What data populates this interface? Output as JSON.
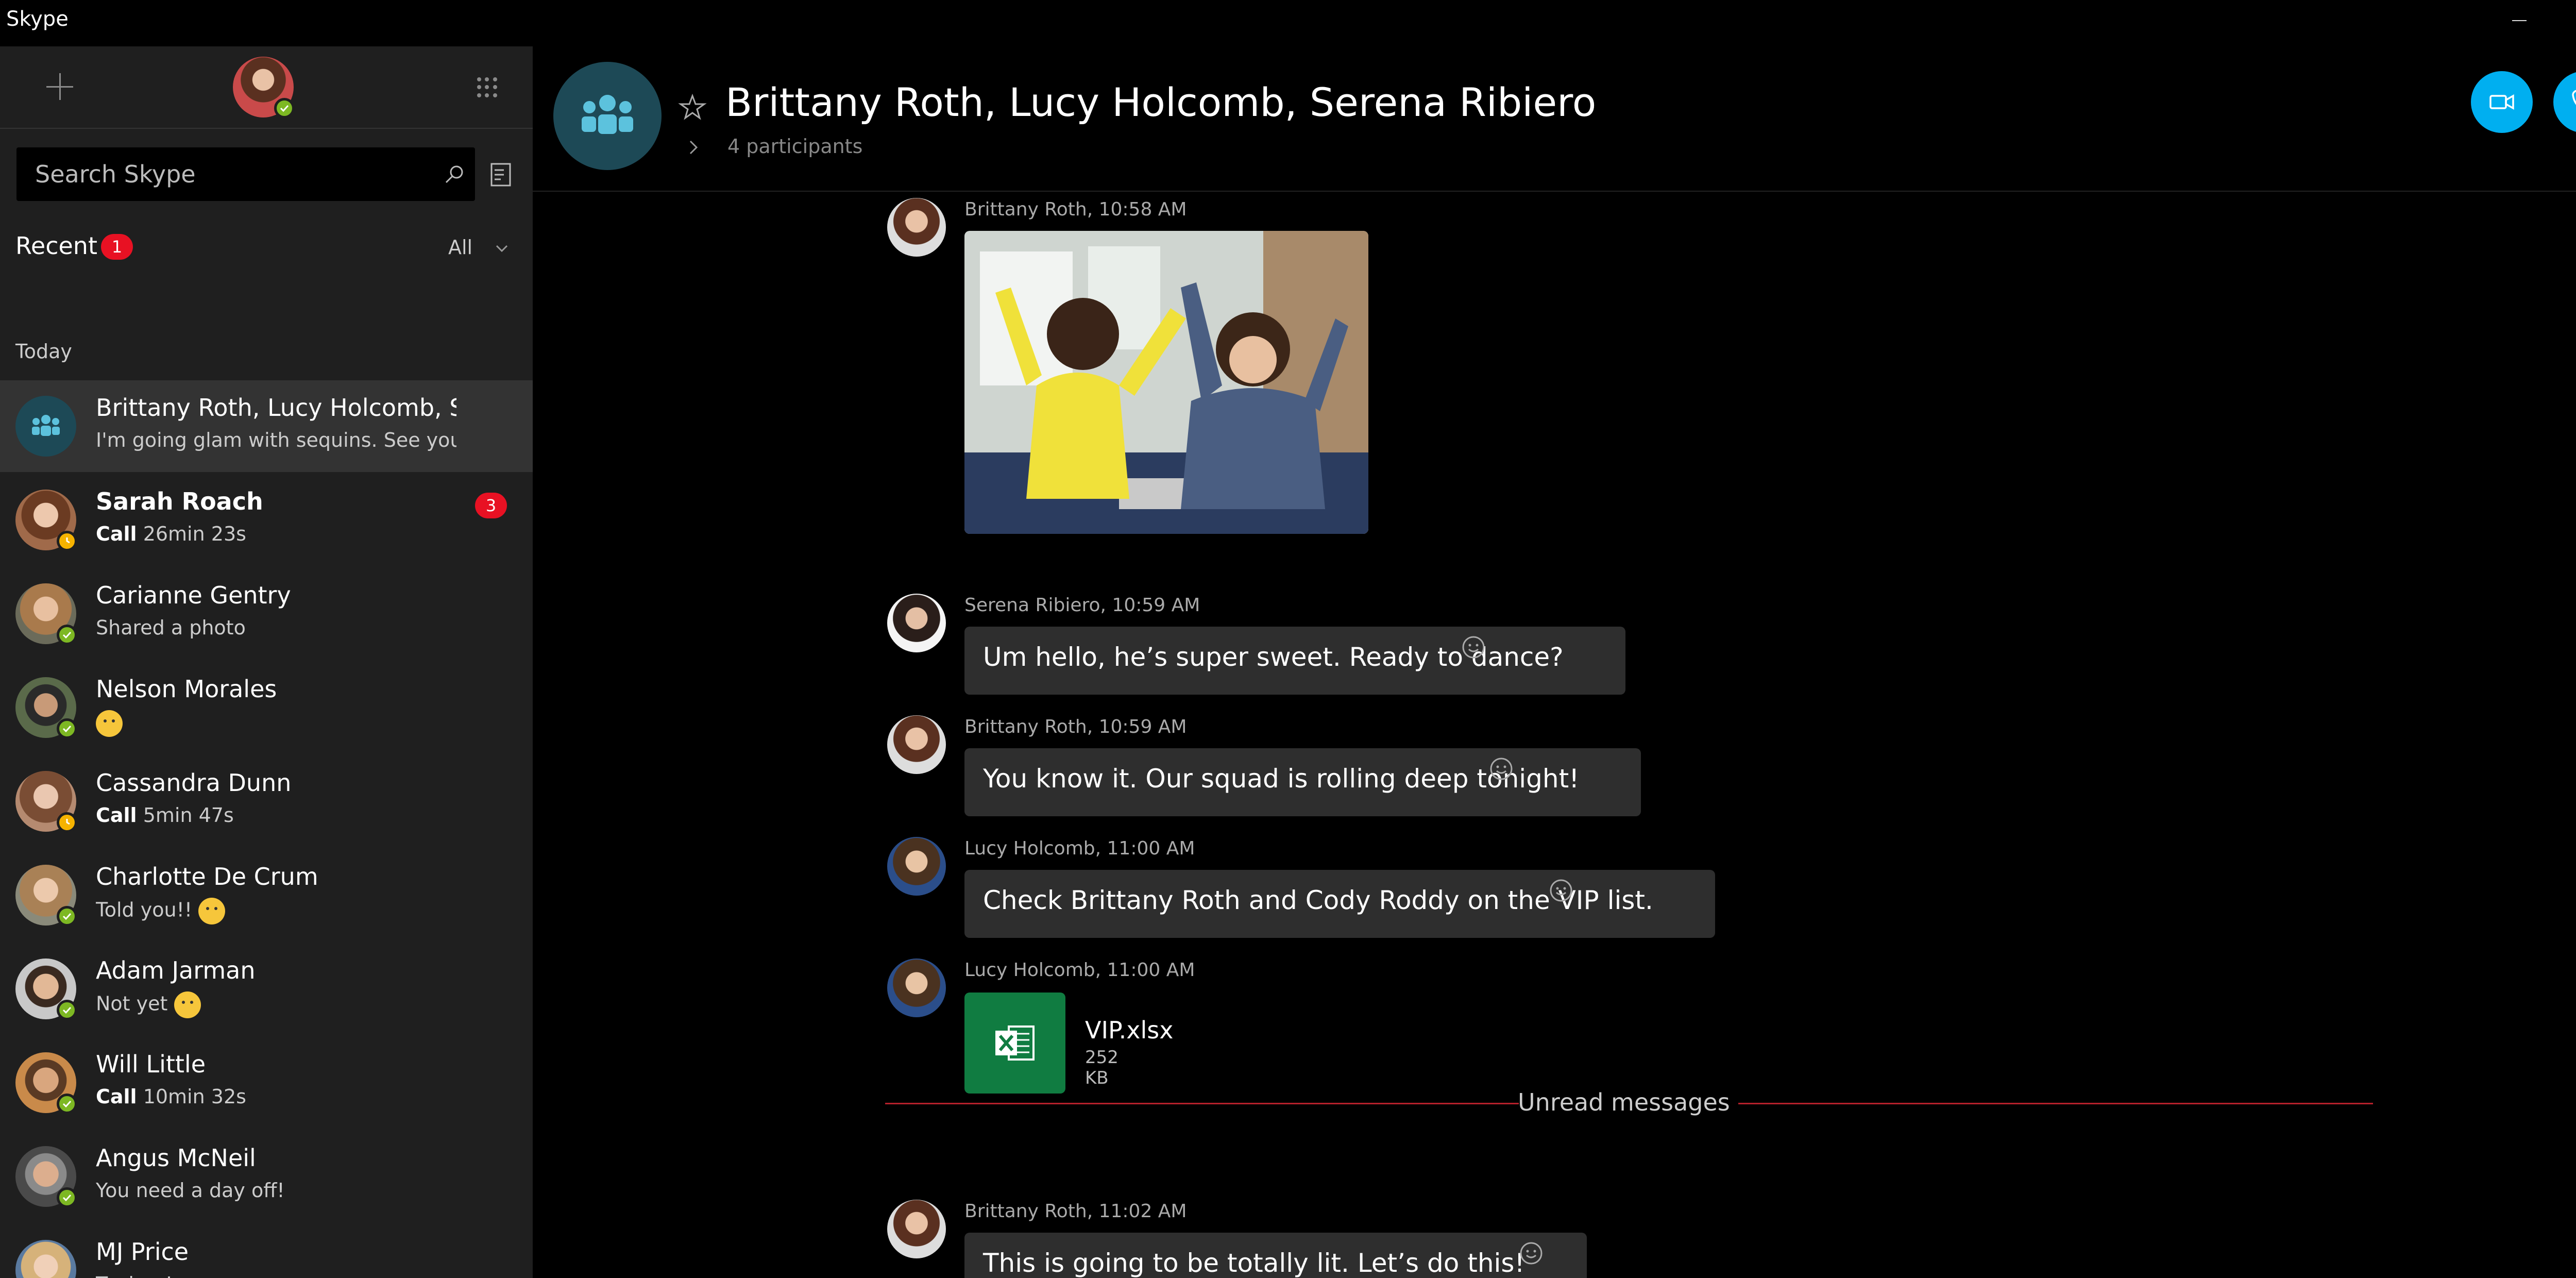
{
  "window": {
    "title": "Skype"
  },
  "sidebar": {
    "search_placeholder": "Search Skype",
    "recent": {
      "label": "Recent",
      "badge": "1",
      "filter": "All"
    },
    "section_today": "Today",
    "chats": [
      {
        "name": "Brittany Roth, Lucy Holcomb, S...",
        "sub": "I'm going glam with sequins. See you h...",
        "type": "group",
        "active": true
      },
      {
        "name": "Sarah Roach",
        "sub_bold": "Call",
        "sub": "26min 23s",
        "badge": "3",
        "status": "away"
      },
      {
        "name": "Carianne Gentry",
        "sub": "Shared a photo",
        "status": "online"
      },
      {
        "name": "Nelson Morales",
        "sub": "",
        "emoji": "sleepy-emoji",
        "status": "online"
      },
      {
        "name": "Cassandra Dunn",
        "sub_bold": "Call",
        "sub": "5min 47s",
        "status": "away"
      },
      {
        "name": "Charlotte De Crum",
        "sub": "Told you!!",
        "emoji": "smile-emoji",
        "status": "online"
      },
      {
        "name": "Adam Jarman",
        "sub": "Not yet",
        "emoji": "sad-emoji",
        "status": "online"
      },
      {
        "name": "Will Little",
        "sub_bold": "Call",
        "sub": "10min 32s",
        "status": "online"
      },
      {
        "name": "Angus McNeil",
        "sub": "You need a day off!",
        "status": "online"
      },
      {
        "name": "MJ Price",
        "sub": "Teehee!",
        "status": "online"
      }
    ]
  },
  "conversation": {
    "title": "Brittany Roth, Lucy Holcomb, Serena Ribiero",
    "participants": "4 participants",
    "messages": [
      {
        "meta": "Brittany Roth, 10:58 AM",
        "kind": "photo"
      },
      {
        "meta": "Serena Ribiero, 10:59 AM",
        "text": "Um hello, he’s super sweet. Ready to dance?"
      },
      {
        "meta": "Brittany Roth, 10:59 AM",
        "text": "You know it. Our squad is rolling deep tonight!"
      },
      {
        "meta": "Lucy Holcomb, 11:00 AM",
        "text": "Check Brittany Roth and Cody Roddy on the VIP list."
      },
      {
        "meta": "Lucy Holcomb, 11:00 AM",
        "kind": "file",
        "file_name": "VIP.xlsx",
        "file_size": "252 KB"
      },
      {
        "meta": "Brittany Roth, 11:02 AM",
        "text": "This is going to be totally lit. Let’s do this!"
      }
    ],
    "unread_label": "Unread messages"
  },
  "colors": {
    "accent": "#00aff0",
    "online": "#7db823",
    "away": "#f6b300",
    "badge": "#e81123",
    "unread_divider": "#b5202b",
    "excel": "#107c41"
  }
}
